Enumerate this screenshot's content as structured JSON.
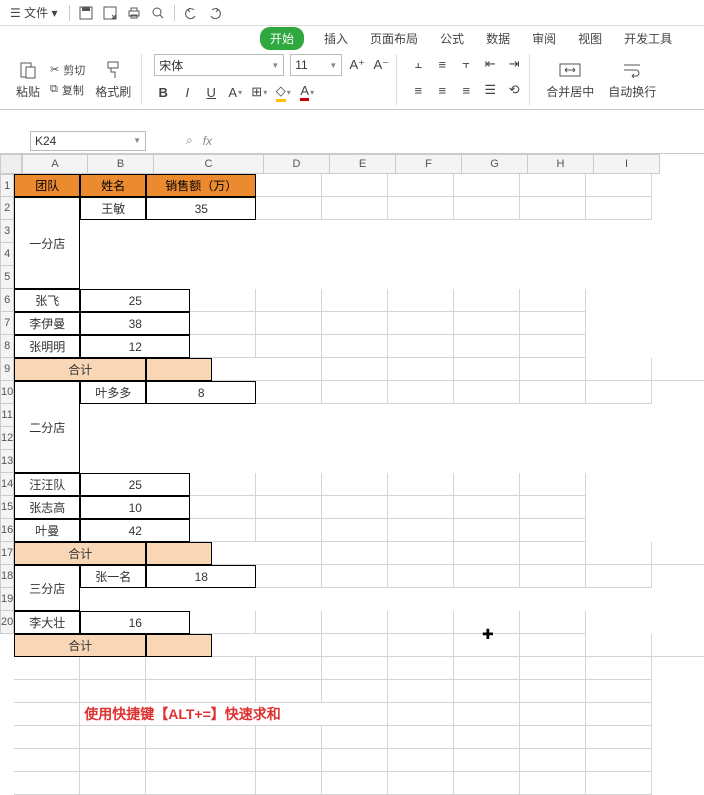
{
  "menu": {
    "file": "文件",
    "dd": "▾"
  },
  "tabs": {
    "start": "开始",
    "insert": "插入",
    "layout": "页面布局",
    "formula": "公式",
    "data": "数据",
    "review": "审阅",
    "view": "视图",
    "dev": "开发工具"
  },
  "ribbon": {
    "paste": "粘贴",
    "cut": "剪切",
    "copy": "复制",
    "fmtpaint": "格式刷",
    "font": "宋体",
    "size": "11",
    "b": "B",
    "i": "I",
    "u": "U",
    "merge": "合并居中",
    "wrap": "自动换行"
  },
  "namebox": "K24",
  "cols": [
    "A",
    "B",
    "C",
    "D",
    "E",
    "F",
    "G",
    "H",
    "I"
  ],
  "colw": {
    "A": 66,
    "B": 66,
    "C": 110,
    "D": 66,
    "E": 66,
    "F": 66,
    "G": 66,
    "H": 66,
    "I": 66
  },
  "hdr": {
    "team": "团队",
    "name": "姓名",
    "sales": "销售额（万）"
  },
  "t1": {
    "team": "一分店",
    "r": [
      [
        "王敏",
        "35"
      ],
      [
        "张飞",
        "25"
      ],
      [
        "李伊曼",
        "38"
      ],
      [
        "张明明",
        "12"
      ]
    ]
  },
  "t2": {
    "team": "二分店",
    "r": [
      [
        "叶多多",
        "8"
      ],
      [
        "汪汪队",
        "25"
      ],
      [
        "张志高",
        "10"
      ],
      [
        "叶曼",
        "42"
      ]
    ]
  },
  "t3": {
    "team": "三分店",
    "r": [
      [
        "张一名",
        "18"
      ],
      [
        "李大壮",
        "16"
      ]
    ]
  },
  "sum": "合计",
  "annot": "使用快捷键【ALT+=】快速求和",
  "chart_data": {
    "type": "table",
    "title": "销售额（万）",
    "columns": [
      "团队",
      "姓名",
      "销售额（万）"
    ],
    "rows": [
      [
        "一分店",
        "王敏",
        35
      ],
      [
        "一分店",
        "张飞",
        25
      ],
      [
        "一分店",
        "李伊曼",
        38
      ],
      [
        "一分店",
        "张明明",
        12
      ],
      [
        "二分店",
        "叶多多",
        8
      ],
      [
        "二分店",
        "汪汪队",
        25
      ],
      [
        "二分店",
        "张志高",
        10
      ],
      [
        "二分店",
        "叶曼",
        42
      ],
      [
        "三分店",
        "张一名",
        18
      ],
      [
        "三分店",
        "李大壮",
        16
      ]
    ]
  }
}
